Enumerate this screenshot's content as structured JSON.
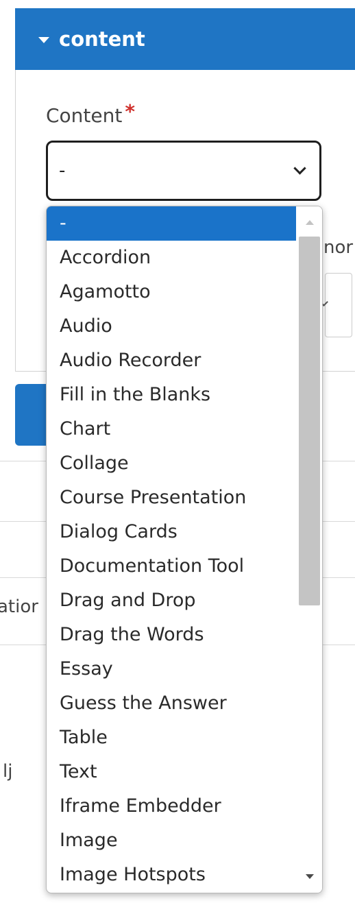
{
  "section": {
    "title": "content"
  },
  "field": {
    "label": "Content",
    "required_marker": "*",
    "selected_value": "-"
  },
  "background": {
    "right_label_fragment": "nor",
    "left_label_fragment": "atior",
    "left_text_fragment": "lj"
  },
  "dropdown": {
    "options": [
      "-",
      "Accordion",
      "Agamotto",
      "Audio",
      "Audio Recorder",
      "Fill in the Blanks",
      "Chart",
      "Collage",
      "Course Presentation",
      "Dialog Cards",
      "Documentation Tool",
      "Drag and Drop",
      "Drag the Words",
      "Essay",
      "Guess the Answer",
      "Table",
      "Text",
      "Iframe Embedder",
      "Image",
      "Image Hotspots"
    ],
    "selected_index": 0
  },
  "colors": {
    "accent": "#1f75c4",
    "selected_option": "#1a73c9",
    "required": "#d0312d"
  }
}
